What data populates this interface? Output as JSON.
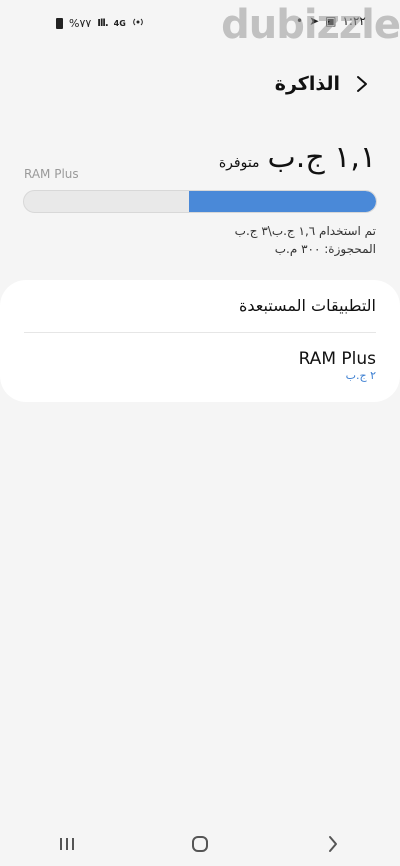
{
  "status_bar": {
    "time": "١:٢٢",
    "battery": "%٧٧",
    "network": "4G"
  },
  "watermark": "dubizzle",
  "header": {
    "title": "الذاكرة"
  },
  "memory": {
    "available_value": "١,١ ج.ب",
    "available_label": "متوفرة",
    "ram_plus_label": "RAM Plus",
    "used_fraction": 0.53,
    "used_text": "تم استخدام ١,٦ ج.ب\\٣ ج.ب",
    "reserved_text": "المحجوزة: ٣٠٠ م.ب"
  },
  "list": {
    "excluded_apps": "التطبيقات المستبعدة",
    "ram_plus_title": "RAM Plus",
    "ram_plus_value": "٢ ج.ب"
  },
  "colors": {
    "accent": "#4a89d8",
    "link": "#3b7ed1"
  }
}
